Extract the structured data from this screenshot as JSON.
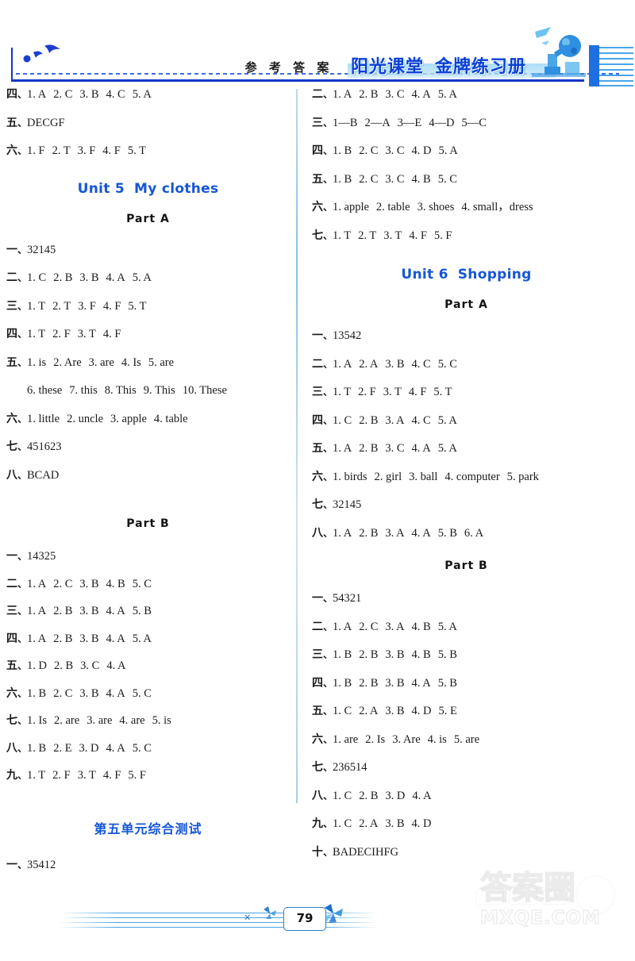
{
  "header": {
    "ref_title": "参 考 答 案",
    "brand_part1": "阳光课堂",
    "brand_part2": "金牌练习册",
    "birds_icon": "flying-birds-icon",
    "telescope_icon": "telescope-observer-icon",
    "notebook_icon": "lined-notebook-icon",
    "accent_color": "#1456d6",
    "rule_color": "#1436c8"
  },
  "left_column": {
    "top_answers": [
      {
        "num": "四",
        "sep": "、",
        "items": [
          "1. A",
          "2. C",
          "3. B",
          "4. C",
          "5. A"
        ]
      },
      {
        "num": "五",
        "sep": "、",
        "items": [
          "DECGF"
        ]
      },
      {
        "num": "六",
        "sep": "、",
        "items": [
          "1. F",
          "2. T",
          "3. F",
          "4. F",
          "5. T"
        ]
      }
    ],
    "unit5": {
      "unit_label": "Unit 5",
      "unit_name": "My clothes",
      "partA_label": "Part A",
      "partA_answers": [
        {
          "num": "一",
          "sep": "、",
          "items": [
            "32145"
          ]
        },
        {
          "num": "二",
          "sep": "、",
          "items": [
            "1. C",
            "2. B",
            "3. B",
            "4. A",
            "5. A"
          ]
        },
        {
          "num": "三",
          "sep": "、",
          "items": [
            "1. T",
            "2. T",
            "3. F",
            "4. F",
            "5. T"
          ]
        },
        {
          "num": "四",
          "sep": "、",
          "items": [
            "1. T",
            "2. F",
            "3. T",
            "4. F"
          ]
        },
        {
          "num": "五",
          "sep": "、",
          "items": [
            "1. is",
            "2. Are",
            "3. are",
            "4. Is",
            "5. are"
          ]
        },
        {
          "num": "",
          "sep": "",
          "indent": true,
          "items": [
            "6. these",
            "7. this",
            "8. This",
            "9. This",
            "10. These"
          ]
        },
        {
          "num": "六",
          "sep": "、",
          "items": [
            "1. little",
            "2. uncle",
            "3. apple",
            "4. table"
          ]
        },
        {
          "num": "七",
          "sep": "、",
          "items": [
            "451623"
          ]
        },
        {
          "num": "八",
          "sep": "、",
          "items": [
            "BCAD"
          ]
        }
      ],
      "partB_label": "Part B",
      "partB_answers": [
        {
          "num": "一",
          "sep": "、",
          "items": [
            "14325"
          ]
        },
        {
          "num": "二",
          "sep": "、",
          "items": [
            "1. A",
            "2. C",
            "3. B",
            "4. B",
            "5. C"
          ]
        },
        {
          "num": "三",
          "sep": "、",
          "items": [
            "1. A",
            "2. B",
            "3. B",
            "4. A",
            "5. B"
          ]
        },
        {
          "num": "四",
          "sep": "、",
          "items": [
            "1. A",
            "2. B",
            "3. B",
            "4. A",
            "5. A"
          ]
        },
        {
          "num": "五",
          "sep": "、",
          "items": [
            "1. D",
            "2. B",
            "3. C",
            "4. A"
          ]
        },
        {
          "num": "六",
          "sep": "、",
          "items": [
            "1. B",
            "2. C",
            "3. B",
            "4. A",
            "5. C"
          ]
        },
        {
          "num": "七",
          "sep": "、",
          "items": [
            "1. Is",
            "2. are",
            "3. are",
            "4. are",
            "5. is"
          ]
        },
        {
          "num": "八",
          "sep": "、",
          "items": [
            "1. B",
            "2. E",
            "3. D",
            "4. A",
            "5. C"
          ]
        },
        {
          "num": "九",
          "sep": "、",
          "items": [
            "1. T",
            "2. F",
            "3. T",
            "4. F",
            "5. F"
          ]
        }
      ]
    },
    "unit5_test": {
      "title": "第五单元综合测试",
      "answers": [
        {
          "num": "一",
          "sep": "、",
          "items": [
            "35412"
          ]
        }
      ]
    }
  },
  "right_column": {
    "top_answers": [
      {
        "num": "二",
        "sep": "、",
        "items": [
          "1. A",
          "2. B",
          "3. C",
          "4. A",
          "5. A"
        ]
      },
      {
        "num": "三",
        "sep": "、",
        "items": [
          "1—B",
          "2—A",
          "3—E",
          "4—D",
          "5—C"
        ]
      },
      {
        "num": "四",
        "sep": "、",
        "items": [
          "1. B",
          "2. C",
          "3. C",
          "4. D",
          "5. A"
        ]
      },
      {
        "num": "五",
        "sep": "、",
        "items": [
          "1. B",
          "2. C",
          "3. C",
          "4. B",
          "5. C"
        ]
      },
      {
        "num": "六",
        "sep": "、",
        "items": [
          "1. apple",
          "2. table",
          "3. shoes",
          "4. small，dress"
        ]
      },
      {
        "num": "七",
        "sep": "、",
        "items": [
          "1. T",
          "2. T",
          "3. T",
          "4. F",
          "5. F"
        ]
      }
    ],
    "unit6": {
      "unit_label": "Unit 6",
      "unit_name": "Shopping",
      "partA_label": "Part A",
      "partA_answers": [
        {
          "num": "一",
          "sep": "、",
          "items": [
            "13542"
          ]
        },
        {
          "num": "二",
          "sep": "、",
          "items": [
            "1. A",
            "2. A",
            "3. B",
            "4. C",
            "5. C"
          ]
        },
        {
          "num": "三",
          "sep": "、",
          "items": [
            "1. T",
            "2. F",
            "3. T",
            "4. F",
            "5. T"
          ]
        },
        {
          "num": "四",
          "sep": "、",
          "items": [
            "1. C",
            "2. B",
            "3. A",
            "4. C",
            "5. A"
          ]
        },
        {
          "num": "五",
          "sep": "、",
          "items": [
            "1. A",
            "2. B",
            "3. C",
            "4. A",
            "5. A"
          ]
        },
        {
          "num": "六",
          "sep": "、",
          "items": [
            "1. birds",
            "2. girl",
            "3. ball",
            "4. computer",
            "5. park"
          ]
        },
        {
          "num": "七",
          "sep": "、",
          "items": [
            "32145"
          ]
        },
        {
          "num": "八",
          "sep": "、",
          "items": [
            "1. A",
            "2. B",
            "3. A",
            "4. A",
            "5. B",
            "6. A"
          ]
        }
      ],
      "partB_label": "Part B",
      "partB_answers": [
        {
          "num": "一",
          "sep": "、",
          "items": [
            "54321"
          ]
        },
        {
          "num": "二",
          "sep": "、",
          "items": [
            "1. A",
            "2. C",
            "3. A",
            "4. B",
            "5. A"
          ]
        },
        {
          "num": "三",
          "sep": "、",
          "items": [
            "1. B",
            "2. B",
            "3. B",
            "4. B",
            "5. B"
          ]
        },
        {
          "num": "四",
          "sep": "、",
          "items": [
            "1. B",
            "2. B",
            "3. B",
            "4. A",
            "5. B"
          ]
        },
        {
          "num": "五",
          "sep": "、",
          "items": [
            "1. C",
            "2. A",
            "3. B",
            "4. D",
            "5. E"
          ]
        },
        {
          "num": "六",
          "sep": "、",
          "items": [
            "1. are",
            "2. Is",
            "3. Are",
            "4. is",
            "5. are"
          ]
        },
        {
          "num": "七",
          "sep": "、",
          "items": [
            "236514"
          ]
        },
        {
          "num": "八",
          "sep": "、",
          "items": [
            "1. C",
            "2. B",
            "3. D",
            "4. A"
          ]
        },
        {
          "num": "九",
          "sep": "、",
          "items": [
            "1. C",
            "2. A",
            "3. B",
            "4. D"
          ]
        },
        {
          "num": "十",
          "sep": "、",
          "items": [
            "BADECIHFG"
          ]
        }
      ]
    }
  },
  "footer": {
    "page_number": "79",
    "pinwheel_icon": "pinwheel-icon",
    "x_icon": "x-mark-icon"
  },
  "watermark": {
    "cn_text": "答案圈",
    "en_text": "MXQE.COM"
  }
}
